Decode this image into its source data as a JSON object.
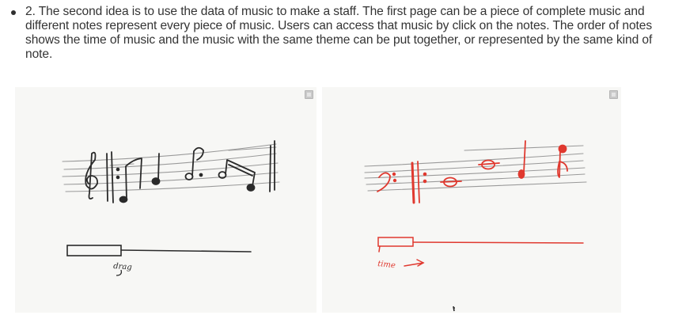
{
  "content": {
    "bullet_text": "2. The second idea is to use the data of music to make a staff. The first page can be a piece of complete music and different notes represent every piece of music. Users can access that music by click on the notes. The order of notes shows the time of music and the music with the same theme can be put together, or represented by the same kind of note."
  },
  "sketches": {
    "left": {
      "handwritten_label": "drag",
      "ink_color": "#2a2a2a",
      "staff_color": "#9a9a9a",
      "icon": "image-expand-icon"
    },
    "right": {
      "handwritten_label": "time",
      "ink_color": "#e0392f",
      "staff_color": "#9a9a9a",
      "icon": "image-expand-icon"
    }
  }
}
